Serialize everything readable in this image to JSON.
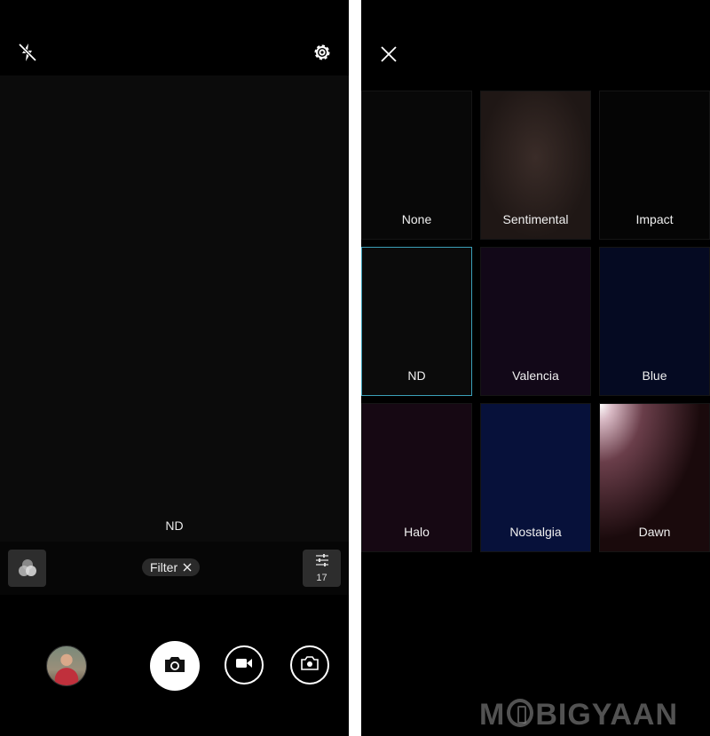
{
  "camera": {
    "current_filter_label": "ND",
    "filter_chip_label": "Filter",
    "adjust_count": "17"
  },
  "filter_picker": {
    "filters": [
      {
        "name": "None",
        "selected": false,
        "color": "#080808"
      },
      {
        "name": "Sentimental",
        "selected": false,
        "color": "#1f1715"
      },
      {
        "name": "Impact",
        "selected": false,
        "color": "#050505"
      },
      {
        "name": "ND",
        "selected": true,
        "color": "#0b0b0b"
      },
      {
        "name": "Valencia",
        "selected": false,
        "color": "#120818"
      },
      {
        "name": "Blue",
        "selected": false,
        "color": "#050a22"
      },
      {
        "name": "Halo",
        "selected": false,
        "color": "#160813"
      },
      {
        "name": "Nostalgia",
        "selected": false,
        "color": "#07113a"
      },
      {
        "name": "Dawn",
        "selected": false,
        "color": "#1a0a0c"
      }
    ]
  },
  "watermark": {
    "text_before": "M",
    "text_after": "BIGYAAN"
  },
  "colors": {
    "selection": "#3a9fb8",
    "background": "#000000"
  }
}
